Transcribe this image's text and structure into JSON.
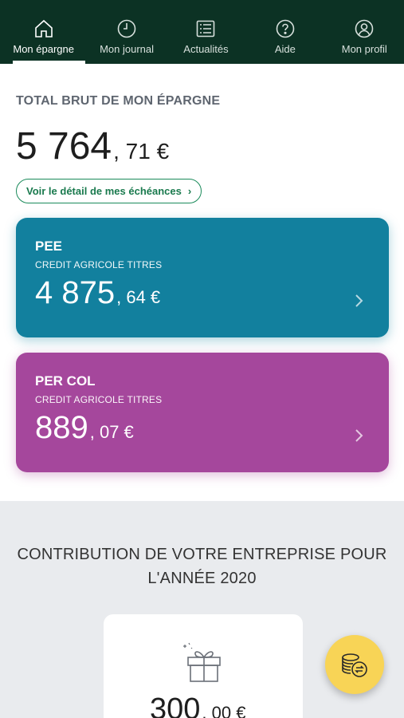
{
  "nav": {
    "items": [
      {
        "label": "Mon épargne",
        "icon": "home-icon"
      },
      {
        "label": "Mon journal",
        "icon": "clock-icon"
      },
      {
        "label": "Actualités",
        "icon": "news-icon"
      },
      {
        "label": "Aide",
        "icon": "help-icon"
      },
      {
        "label": "Mon profil",
        "icon": "profile-icon"
      }
    ],
    "active": "Mon épargne"
  },
  "total": {
    "title": "TOTAL BRUT DE MON ÉPARGNE",
    "amount_int": "5 764",
    "amount_dec": ", 71 €",
    "detail_button": "Voir le détail de mes échéances"
  },
  "accounts": [
    {
      "title": "PEE",
      "subtitle": "CREDIT AGRICOLE TITRES",
      "amount_int": "4 875",
      "amount_dec": ", 64 €",
      "color": "#12809e"
    },
    {
      "title": "PER COL",
      "subtitle": "CREDIT AGRICOLE TITRES",
      "amount_int": "889",
      "amount_dec": ", 07 €",
      "color": "#a5479c"
    }
  ],
  "contribution": {
    "title_line1": "CONTRIBUTION DE VOTRE ENTREPRISE POUR",
    "title_line2": "L'ANNÉE 2020",
    "amount_int": "300",
    "amount_dec": ", 00 €"
  },
  "colors": {
    "nav_bg": "#0c3224",
    "accent_green": "#1a8a5a",
    "fab": "#f8d456"
  }
}
